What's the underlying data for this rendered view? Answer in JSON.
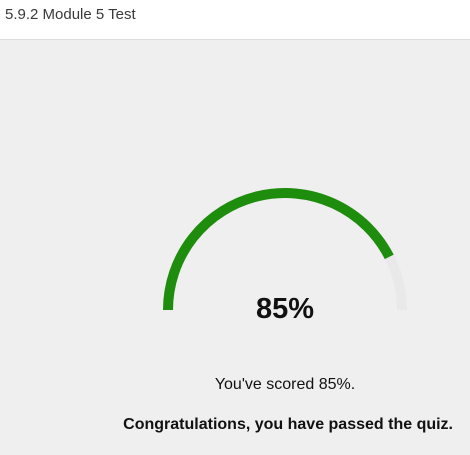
{
  "header": {
    "title": "5.9.2 Module 5 Test"
  },
  "result": {
    "score_value": 0.85,
    "score_label": "85%",
    "score_text": "You've scored 85%.",
    "message": "Congratulations, you have passed the quiz."
  },
  "colors": {
    "gauge_fill": "#1e8c0c",
    "gauge_track": "#e9e9e9",
    "background": "#efefef"
  }
}
